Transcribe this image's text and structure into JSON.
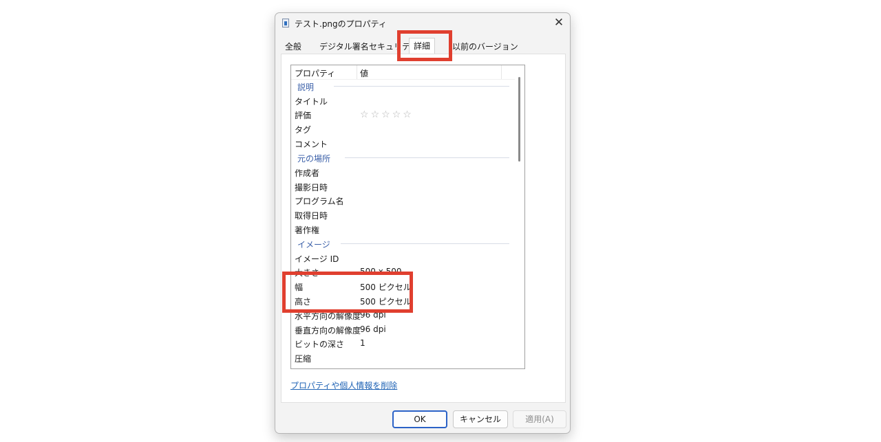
{
  "window": {
    "title": "テスト.pngのプロパティ",
    "close_glyph": "✕"
  },
  "tabs": [
    {
      "label": "全般"
    },
    {
      "label": "デジタル署名"
    },
    {
      "label": "セキュリティ"
    },
    {
      "label": "詳細",
      "active": true
    },
    {
      "label": "以前のバージョン"
    }
  ],
  "list": {
    "header": {
      "property": "プロパティ",
      "value": "値"
    },
    "groups": {
      "description": "説明",
      "origin": "元の場所",
      "image": "イメージ"
    },
    "rows": {
      "title": {
        "key": "タイトル",
        "value": ""
      },
      "rating": {
        "key": "評価",
        "stars": 5,
        "filled": 0
      },
      "tags": {
        "key": "タグ",
        "value": ""
      },
      "comments": {
        "key": "コメント",
        "value": ""
      },
      "author": {
        "key": "作成者",
        "value": ""
      },
      "date_taken": {
        "key": "撮影日時",
        "value": ""
      },
      "program": {
        "key": "プログラム名",
        "value": ""
      },
      "date_acquired": {
        "key": "取得日時",
        "value": ""
      },
      "copyright": {
        "key": "著作権",
        "value": ""
      },
      "image_id": {
        "key": "イメージ ID",
        "value": ""
      },
      "dimensions": {
        "key": "大きさ",
        "value": "500 x 500"
      },
      "width": {
        "key": "幅",
        "value": "500 ピクセル"
      },
      "height": {
        "key": "高さ",
        "value": "500 ピクセル"
      },
      "h_resolution": {
        "key": "水平方向の解像度",
        "value": "96 dpi"
      },
      "v_resolution": {
        "key": "垂直方向の解像度",
        "value": "96 dpi"
      },
      "bit_depth": {
        "key": "ビットの深さ",
        "value": "1"
      },
      "compression": {
        "key": "圧縮",
        "value": ""
      }
    }
  },
  "remove_link": "プロパティや個人情報を削除",
  "buttons": {
    "ok": "OK",
    "cancel": "キャンセル",
    "apply": "適用(A)"
  },
  "colors": {
    "highlight": "#e03f2f",
    "link": "#1f63b5",
    "group_header": "#3a5fa8"
  }
}
